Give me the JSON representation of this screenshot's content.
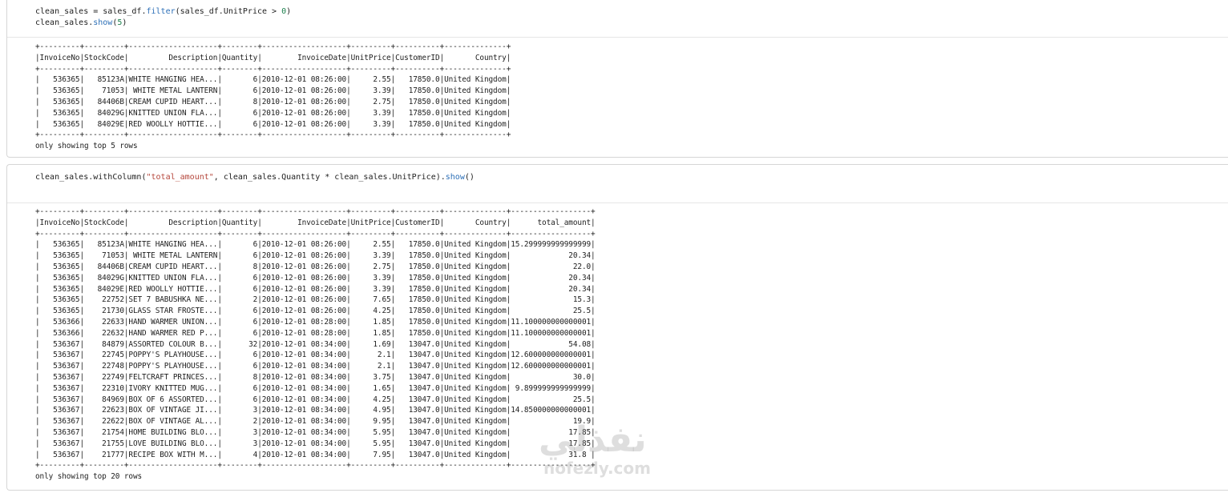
{
  "cell1": {
    "code_lines": [
      {
        "prefix": "clean_sales = sales_df.",
        "fn": "filter",
        "mid": "(sales_df.UnitPrice > ",
        "num": "0",
        "suffix": ")"
      },
      {
        "prefix": "clean_sales.",
        "fn": "show",
        "mid": "(",
        "num": "5",
        "suffix": ")"
      }
    ],
    "output": "+---------+---------+--------------------+--------+-------------------+---------+----------+--------------+\n|InvoiceNo|StockCode|         Description|Quantity|        InvoiceDate|UnitPrice|CustomerID|       Country|\n+---------+---------+--------------------+--------+-------------------+---------+----------+--------------+\n|   536365|   85123A|WHITE HANGING HEA...|       6|2010-12-01 08:26:00|     2.55|   17850.0|United Kingdom|\n|   536365|    71053| WHITE METAL LANTERN|       6|2010-12-01 08:26:00|     3.39|   17850.0|United Kingdom|\n|   536365|   84406B|CREAM CUPID HEART...|       8|2010-12-01 08:26:00|     2.75|   17850.0|United Kingdom|\n|   536365|   84029G|KNITTED UNION FLA...|       6|2010-12-01 08:26:00|     3.39|   17850.0|United Kingdom|\n|   536365|   84029E|RED WOOLLY HOTTIE...|       6|2010-12-01 08:26:00|     3.39|   17850.0|United Kingdom|\n+---------+---------+--------------------+--------+-------------------+---------+----------+--------------+\nonly showing top 5 rows"
  },
  "cell2": {
    "code": {
      "prefix": "clean_sales.withColumn(",
      "str": "\"total_amount\"",
      "mid": ", clean_sales.Quantity * clean_sales.UnitPrice).",
      "fn": "show",
      "suffix": "()"
    },
    "output": "+---------+---------+--------------------+--------+-------------------+---------+----------+--------------+------------------+\n|InvoiceNo|StockCode|         Description|Quantity|        InvoiceDate|UnitPrice|CustomerID|       Country|      total_amount|\n+---------+---------+--------------------+--------+-------------------+---------+----------+--------------+------------------+\n|   536365|   85123A|WHITE HANGING HEA...|       6|2010-12-01 08:26:00|     2.55|   17850.0|United Kingdom|15.299999999999999|\n|   536365|    71053| WHITE METAL LANTERN|       6|2010-12-01 08:26:00|     3.39|   17850.0|United Kingdom|             20.34|\n|   536365|   84406B|CREAM CUPID HEART...|       8|2010-12-01 08:26:00|     2.75|   17850.0|United Kingdom|              22.0|\n|   536365|   84029G|KNITTED UNION FLA...|       6|2010-12-01 08:26:00|     3.39|   17850.0|United Kingdom|             20.34|\n|   536365|   84029E|RED WOOLLY HOTTIE...|       6|2010-12-01 08:26:00|     3.39|   17850.0|United Kingdom|             20.34|\n|   536365|    22752|SET 7 BABUSHKA NE...|       2|2010-12-01 08:26:00|     7.65|   17850.0|United Kingdom|              15.3|\n|   536365|    21730|GLASS STAR FROSTE...|       6|2010-12-01 08:26:00|     4.25|   17850.0|United Kingdom|              25.5|\n|   536366|    22633|HAND WARMER UNION...|       6|2010-12-01 08:28:00|     1.85|   17850.0|United Kingdom|11.100000000000001|\n|   536366|    22632|HAND WARMER RED P...|       6|2010-12-01 08:28:00|     1.85|   17850.0|United Kingdom|11.100000000000001|\n|   536367|    84879|ASSORTED COLOUR B...|      32|2010-12-01 08:34:00|     1.69|   13047.0|United Kingdom|             54.08|\n|   536367|    22745|POPPY'S PLAYHOUSE...|       6|2010-12-01 08:34:00|      2.1|   13047.0|United Kingdom|12.600000000000001|\n|   536367|    22748|POPPY'S PLAYHOUSE...|       6|2010-12-01 08:34:00|      2.1|   13047.0|United Kingdom|12.600000000000001|\n|   536367|    22749|FELTCRAFT PRINCES...|       8|2010-12-01 08:34:00|     3.75|   13047.0|United Kingdom|              30.0|\n|   536367|    22310|IVORY KNITTED MUG...|       6|2010-12-01 08:34:00|     1.65|   13047.0|United Kingdom| 9.899999999999999|\n|   536367|    84969|BOX OF 6 ASSORTED...|       6|2010-12-01 08:34:00|     4.25|   13047.0|United Kingdom|              25.5|\n|   536367|    22623|BOX OF VINTAGE JI...|       3|2010-12-01 08:34:00|     4.95|   13047.0|United Kingdom|14.850000000000001|\n|   536367|    22622|BOX OF VINTAGE AL...|       2|2010-12-01 08:34:00|     9.95|   13047.0|United Kingdom|              19.9|\n|   536367|    21754|HOME BUILDING BLO...|       3|2010-12-01 08:34:00|     5.95|   13047.0|United Kingdom|             17.85|\n|   536367|    21755|LOVE BUILDING BLO...|       3|2010-12-01 08:34:00|     5.95|   13047.0|United Kingdom|             17.85|\n|   536367|    21777|RECIPE BOX WITH M...|       4|2010-12-01 08:34:00|     7.95|   13047.0|United Kingdom|             31.8 |\n+---------+---------+--------------------+--------+-------------------+---------+----------+--------------+------------------+\nonly showing top 20 rows"
  },
  "watermark": {
    "arabic": "نفذلي",
    "latin": "nofezly.com"
  },
  "colors": {
    "string": "#b5463b",
    "number": "#1a7f4b",
    "function": "#2c6fb7",
    "border": "#d6d6d6"
  }
}
